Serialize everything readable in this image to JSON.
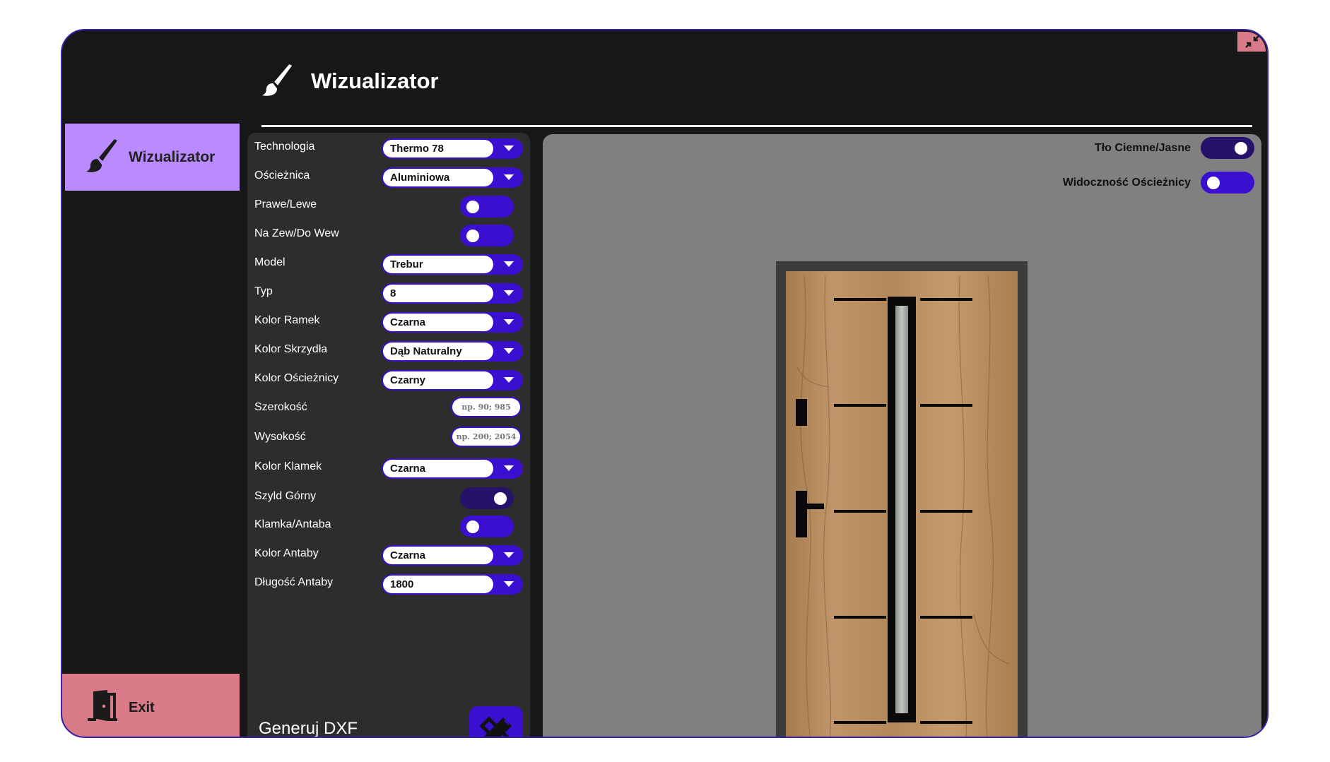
{
  "app": {
    "title": "Wizualizator"
  },
  "sidebar": {
    "items": [
      {
        "label": "Wizualizator",
        "icon": "paint-brush-icon",
        "active": true
      }
    ],
    "exit_label": "Exit",
    "exit_icon": "door-exit-icon"
  },
  "form": {
    "rows": [
      {
        "label": "Technologia",
        "control": "combo",
        "value": "Thermo 78"
      },
      {
        "label": "Ościeżnica",
        "control": "combo",
        "value": "Aluminiowa"
      },
      {
        "label": "Prawe/Lewe",
        "control": "toggle",
        "state": "off"
      },
      {
        "label": "Na Zew/Do Wew",
        "control": "toggle",
        "state": "off"
      },
      {
        "label": "Model",
        "control": "combo",
        "value": "Trebur"
      },
      {
        "label": "Typ",
        "control": "combo",
        "value": "8"
      },
      {
        "label": "Kolor Ramek",
        "control": "combo",
        "value": "Czarna"
      },
      {
        "label": "Kolor Skrzydła",
        "control": "combo",
        "value": "Dąb Naturalny"
      },
      {
        "label": "Kolor Ościeżnicy",
        "control": "combo",
        "value": "Czarny"
      },
      {
        "label": "Szerokość",
        "control": "text",
        "placeholder": "np. 90; 985"
      },
      {
        "label": "Wysokość",
        "control": "text",
        "placeholder": "np. 200; 2054"
      },
      {
        "label": "Kolor Klamek",
        "control": "combo",
        "value": "Czarna"
      },
      {
        "label": "Szyld Górny",
        "control": "toggle",
        "state": "on"
      },
      {
        "label": "Klamka/Antaba",
        "control": "toggle",
        "state": "off"
      },
      {
        "label": "Kolor Antaby",
        "control": "combo",
        "value": "Czarna"
      },
      {
        "label": "Długość Antaby",
        "control": "combo",
        "value": "1800"
      }
    ],
    "generate_label": "Generuj DXF",
    "generate_icon": "pencil-ruler-icon"
  },
  "preview": {
    "background_toggle_label": "Tło Ciemne/Jasne",
    "background_toggle_state": "on",
    "frame_visibility_label": "Widoczność Ościeżnicy",
    "frame_visibility_state": "off",
    "door_finish_color": "#b88a5a",
    "door_frame_color": "#3c3c3c"
  },
  "colors": {
    "accent": "#3a0fcf",
    "accent_dark": "#26116b",
    "active_nav": "#b98bff",
    "exit": "#d97a89",
    "panel": "#2d2d2d",
    "window_bg": "#171717",
    "preview_bg": "#808080"
  }
}
